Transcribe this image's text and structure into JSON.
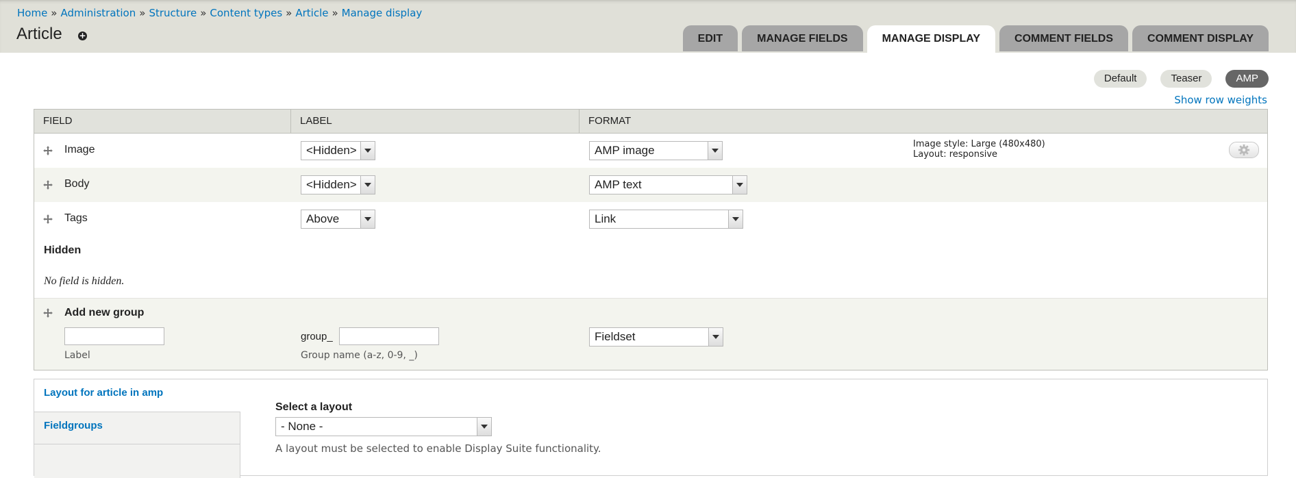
{
  "breadcrumb": [
    "Home",
    "Administration",
    "Structure",
    "Content types",
    "Article",
    "Manage display"
  ],
  "breadcrumb_separator": "»",
  "page_title": "Article",
  "shortcut_icon": "+",
  "tabs": [
    {
      "label": "Edit",
      "active": false
    },
    {
      "label": "Manage fields",
      "active": false
    },
    {
      "label": "Manage display",
      "active": true
    },
    {
      "label": "Comment fields",
      "active": false
    },
    {
      "label": "Comment display",
      "active": false
    }
  ],
  "view_modes": [
    {
      "label": "Default",
      "active": false
    },
    {
      "label": "Teaser",
      "active": false
    },
    {
      "label": "AMP",
      "active": true
    }
  ],
  "show_row_weights": "Show row weights",
  "table": {
    "headers": [
      "FIELD",
      "LABEL",
      "FORMAT"
    ],
    "rows": [
      {
        "field": "Image",
        "label": "<Hidden>",
        "format": "AMP image",
        "summary": [
          "Image style: Large (480x480)",
          "Layout: responsive"
        ]
      },
      {
        "field": "Body",
        "label": "<Hidden>",
        "format": "AMP text"
      },
      {
        "field": "Tags",
        "label": "Above",
        "format": "Link"
      }
    ],
    "hidden_region_title": "Hidden",
    "hidden_empty_text": "No field is hidden.",
    "add_group": {
      "title": "Add new group",
      "label_value": "",
      "label_desc": "Label",
      "group_prefix": "group_",
      "group_name_value": "",
      "group_desc": "Group name (a-z, 0-9, _)",
      "format": "Fieldset"
    }
  },
  "display_suite": {
    "vertical_tabs": [
      "Layout for article in amp",
      "Fieldgroups"
    ],
    "select_label": "Select a layout",
    "select_value": "- None -",
    "description": "A layout must be selected to enable Display Suite functionality."
  },
  "colors": {
    "link": "#0074bd",
    "header_bg": "#e0e0d8",
    "tab_bg": "#a6a6a6",
    "active_pill": "#666666"
  },
  "icons": {
    "drag": "drag-handle-icon",
    "gear": "gear-icon",
    "shortcut": "add-shortcut-icon"
  }
}
